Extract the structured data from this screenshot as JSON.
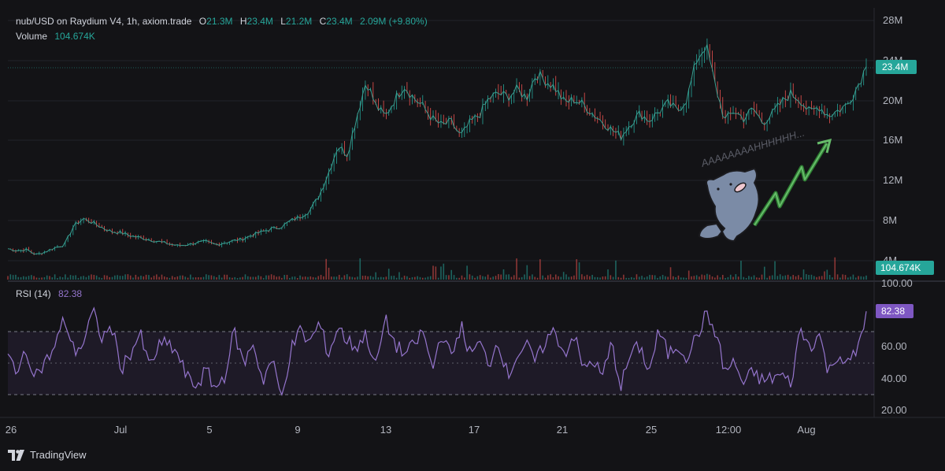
{
  "legend": {
    "title": "nub/USD on Raydium V4, 1h, axiom.trade",
    "o_label": "O",
    "o_value": "21.3M",
    "h_label": "H",
    "h_value": "23.4M",
    "l_label": "L",
    "l_value": "21.2M",
    "c_label": "C",
    "c_value": "23.4M",
    "change": "2.09M (+9.80%)",
    "volume_label": "Volume",
    "volume_value": "104.674K"
  },
  "rsi_legend": {
    "label": "RSI (14)",
    "value": "82.38"
  },
  "badges": {
    "price": "23.4M",
    "volume": "104.674K",
    "rsi": "82.38"
  },
  "price_axis_ticks": [
    "28M",
    "24M",
    "20M",
    "16M",
    "12M",
    "8M",
    "4M"
  ],
  "rsi_axis_ticks": [
    "100.00",
    "60.00",
    "40.00",
    "20.00"
  ],
  "time_axis_ticks": [
    "26",
    "Jul",
    "5",
    "9",
    "13",
    "17",
    "21",
    "25",
    "12:00",
    "Aug"
  ],
  "sticker_text": "AAAAAAAAHHHHHH...",
  "footer": {
    "brand": "TradingView"
  },
  "colors": {
    "up": "#26a69a",
    "down": "#ef5350",
    "rsi": "#9575cd",
    "background": "#131316"
  },
  "chart_data": {
    "type": "line",
    "title": "nub/USD on Raydium V4, 1h, axiom.trade",
    "x_ticks": [
      "26",
      "Jul",
      "5",
      "9",
      "13",
      "17",
      "21",
      "25",
      "12:00",
      "Aug"
    ],
    "price_axis_ticks": [
      "28M",
      "24M",
      "20M",
      "16M",
      "12M",
      "8M",
      "4M"
    ],
    "ylim_price": [
      4,
      28
    ],
    "price_series": {
      "name": "Price (M)",
      "values": [
        5.2,
        5.0,
        5.1,
        4.6,
        4.9,
        5.3,
        5.6,
        7.5,
        8.2,
        7.8,
        7.3,
        6.9,
        6.8,
        6.5,
        6.3,
        6.1,
        5.9,
        5.7,
        5.5,
        5.6,
        5.8,
        5.9,
        5.6,
        5.8,
        6.0,
        6.2,
        6.6,
        6.9,
        7.2,
        7.4,
        8.0,
        8.4,
        9.0,
        10.5,
        12.8,
        15.5,
        14.6,
        18.5,
        22.0,
        19.5,
        18.4,
        20.1,
        21.5,
        20.3,
        19.4,
        18.2,
        17.5,
        17.9,
        16.4,
        17.8,
        18.6,
        20.2,
        20.7,
        20.4,
        21.1,
        20.3,
        22.7,
        22.0,
        21.3,
        19.8,
        20.1,
        19.6,
        18.7,
        17.9,
        17.1,
        16.4,
        17.7,
        18.7,
        18.0,
        18.9,
        19.7,
        19.0,
        20.2,
        24.0,
        25.6,
        21.5,
        18.0,
        19.0,
        18.2,
        19.2,
        17.8,
        18.6,
        19.8,
        20.7,
        20.1,
        18.8,
        19.4,
        18.5,
        19.0,
        19.6,
        21.3,
        23.4
      ]
    },
    "volume": {
      "name": "Volume",
      "last_value": "104.674K"
    },
    "rsi": {
      "name": "RSI (14)",
      "ylim": [
        20,
        100
      ],
      "bands": [
        70,
        50,
        30
      ],
      "values": [
        53,
        46,
        55,
        43,
        50,
        60,
        78,
        57,
        62,
        82,
        65,
        73,
        46,
        56,
        68,
        47,
        60,
        62,
        55,
        40,
        35,
        45,
        33,
        42,
        70,
        48,
        63,
        38,
        52,
        27,
        58,
        70,
        62,
        75,
        55,
        73,
        63,
        60,
        68,
        47,
        77,
        62,
        55,
        60,
        70,
        45,
        70,
        52,
        74,
        55,
        62,
        49,
        64,
        41,
        55,
        60,
        50,
        64,
        70,
        55,
        68,
        45,
        52,
        40,
        62,
        35,
        55,
        60,
        44,
        70,
        55,
        61,
        54,
        66,
        80,
        70,
        44,
        50,
        36,
        44,
        38,
        40,
        42,
        36,
        71,
        60,
        68,
        43,
        56,
        48,
        57,
        82.38
      ]
    }
  }
}
